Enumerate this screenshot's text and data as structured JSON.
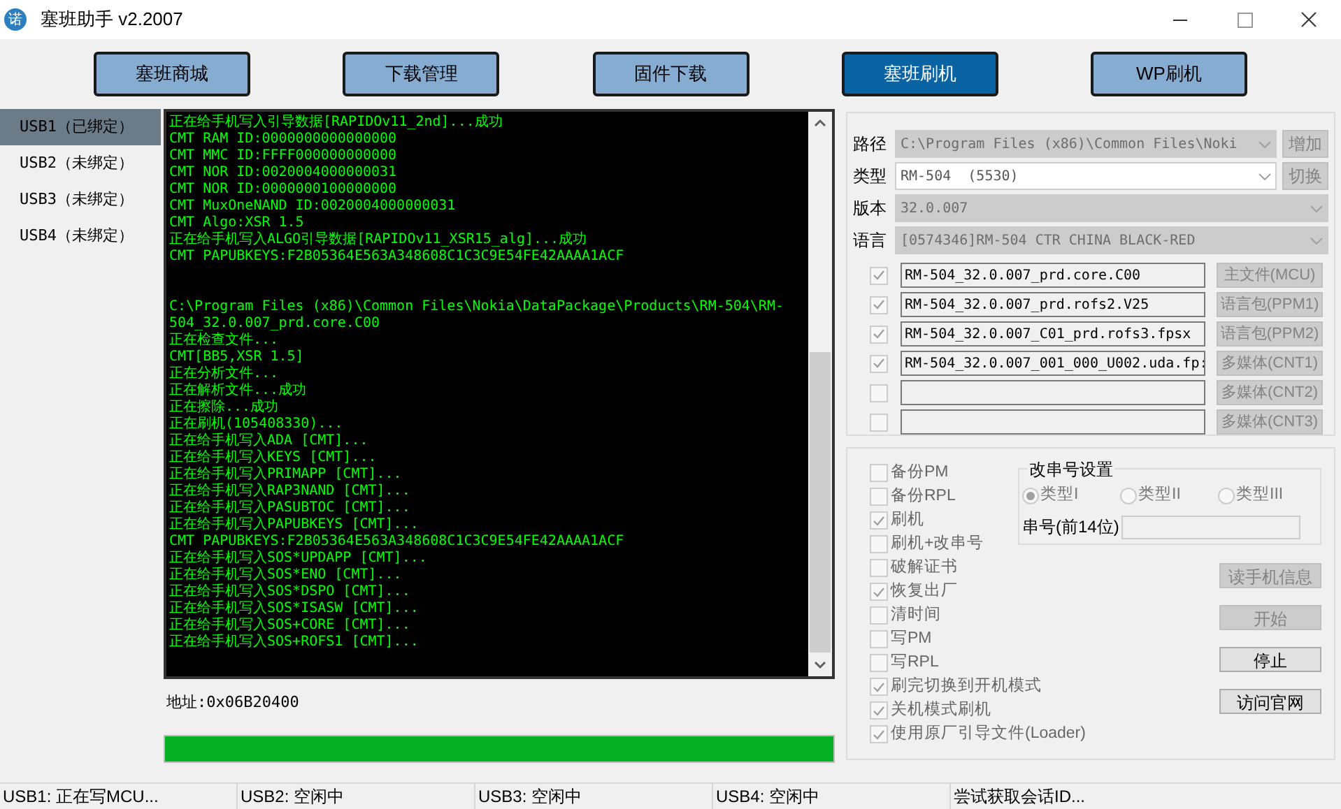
{
  "window": {
    "icon_glyph": "诺",
    "title": "塞班助手 v2.2007"
  },
  "nav_buttons": [
    {
      "label": "塞班商城",
      "selected": false
    },
    {
      "label": "下载管理",
      "selected": false
    },
    {
      "label": "固件下载",
      "selected": false
    },
    {
      "label": "塞班刷机",
      "selected": true
    },
    {
      "label": "WP刷机",
      "selected": false
    }
  ],
  "usb_list": [
    {
      "label": "USB1（已绑定）",
      "selected": true
    },
    {
      "label": "USB2（未绑定）",
      "selected": false
    },
    {
      "label": "USB3（未绑定）",
      "selected": false
    },
    {
      "label": "USB4（未绑定）",
      "selected": false
    }
  ],
  "console": {
    "blocks": [
      [
        "正在给手机写入引导数据[RAPIDOv11_2nd]...成功",
        "CMT RAM ID:0000000000000000",
        "CMT MMC ID:FFFF000000000000",
        "CMT NOR ID:0020004000000031",
        "CMT NOR ID:0000000100000000",
        "CMT MuxOneNAND ID:0020004000000031",
        "CMT Algo:XSR 1.5",
        "正在给手机写入ALGO引导数据[RAPIDOv11_XSR15_alg]...成功",
        "CMT PAPUBKEYS:F2B05364E563A348608C1C3C9E54FE42AAAA1ACF"
      ],
      [
        "C:\\Program Files (x86)\\Common Files\\Nokia\\DataPackage\\Products\\RM-504\\RM-",
        "504_32.0.007_prd.core.C00",
        "正在检查文件...",
        "CMT[BB5,XSR 1.5]",
        "正在分析文件...",
        "正在解析文件...成功",
        "正在擦除...成功",
        "正在刷机(105408330)...",
        "正在给手机写入ADA [CMT]...",
        "正在给手机写入KEYS [CMT]...",
        "正在给手机写入PRIMAPP [CMT]...",
        "正在给手机写入RAP3NAND [CMT]...",
        "正在给手机写入PASUBTOC [CMT]...",
        "正在给手机写入PAPUBKEYS [CMT]...",
        "CMT PAPUBKEYS:F2B05364E563A348608C1C3C9E54FE42AAAA1ACF",
        "正在给手机写入SOS*UPDAPP [CMT]...",
        "正在给手机写入SOS*ENO [CMT]...",
        "正在给手机写入SOS*DSPO [CMT]...",
        "正在给手机写入SOS*ISASW [CMT]...",
        "正在给手机写入SOS+CORE [CMT]...",
        "正在给手机写入SOS+ROFS1 [CMT]..."
      ]
    ]
  },
  "address": "地址:0x06B20400",
  "progress": {
    "level": 1
  },
  "selects": [
    {
      "label": "路径",
      "value": "C:\\Program Files (x86)\\Common Files\\Noki",
      "disabled": true,
      "button": {
        "label": "增加",
        "disabled": true
      }
    },
    {
      "label": "类型",
      "value": "RM-504  (5530)",
      "disabled": false,
      "button": {
        "label": "切换",
        "disabled": true
      }
    },
    {
      "label": "版本",
      "value": "32.0.007",
      "disabled": true
    },
    {
      "label": "语言",
      "value": "[0574346]RM-504 CTR CHINA BLACK-RED",
      "disabled": true
    }
  ],
  "files": [
    {
      "checked": true,
      "value": "RM-504_32.0.007_prd.core.C00",
      "button": "主文件(MCU)"
    },
    {
      "checked": true,
      "value": "RM-504_32.0.007_prd.rofs2.V25",
      "button": "语言包(PPM1)"
    },
    {
      "checked": true,
      "value": "RM-504_32.0.007_C01_prd.rofs3.fpsx",
      "button": "语言包(PPM2)"
    },
    {
      "checked": true,
      "value": "RM-504_32.0.007_001_000_U002.uda.fp:",
      "button": "多媒体(CNT1)"
    },
    {
      "checked": false,
      "button": "多媒体(CNT2)"
    },
    {
      "checked": false,
      "button": "多媒体(CNT3)"
    }
  ],
  "options": [
    {
      "label": "备份PM",
      "checked": false
    },
    {
      "label": "备份RPL",
      "checked": false
    },
    {
      "label": "刷机",
      "checked": true
    },
    {
      "label": "刷机+改串号",
      "checked": false
    },
    {
      "label": "破解证书",
      "checked": false
    },
    {
      "label": "恢复出厂",
      "checked": true
    },
    {
      "label": "清时间",
      "checked": false
    },
    {
      "label": "写PM",
      "checked": false
    },
    {
      "label": "写RPL",
      "checked": false
    },
    {
      "label": "刷完切换到开机模式",
      "checked": true
    },
    {
      "label": "关机模式刷机",
      "checked": true
    },
    {
      "label": "使用原厂引导文件(Loader)",
      "checked": true
    }
  ],
  "serial_settings": {
    "title": "改串号设置",
    "types": [
      {
        "label": "类型I",
        "selected": true
      },
      {
        "label": "类型II",
        "selected": false
      },
      {
        "label": "类型III",
        "selected": false
      }
    ],
    "serial_label": "串号(前14位)"
  },
  "action_buttons": [
    {
      "label": "读手机信息",
      "disabled": true
    },
    {
      "label": "开始",
      "disabled": true
    },
    {
      "label": "停止",
      "disabled": false
    },
    {
      "label": "访问官网",
      "disabled": false
    }
  ],
  "status_bar": [
    "USB1: 正在写MCU...",
    "USB2: 空闲中",
    "USB3: 空闲中",
    "USB4: 空闲中",
    "尝试获取会话ID..."
  ]
}
